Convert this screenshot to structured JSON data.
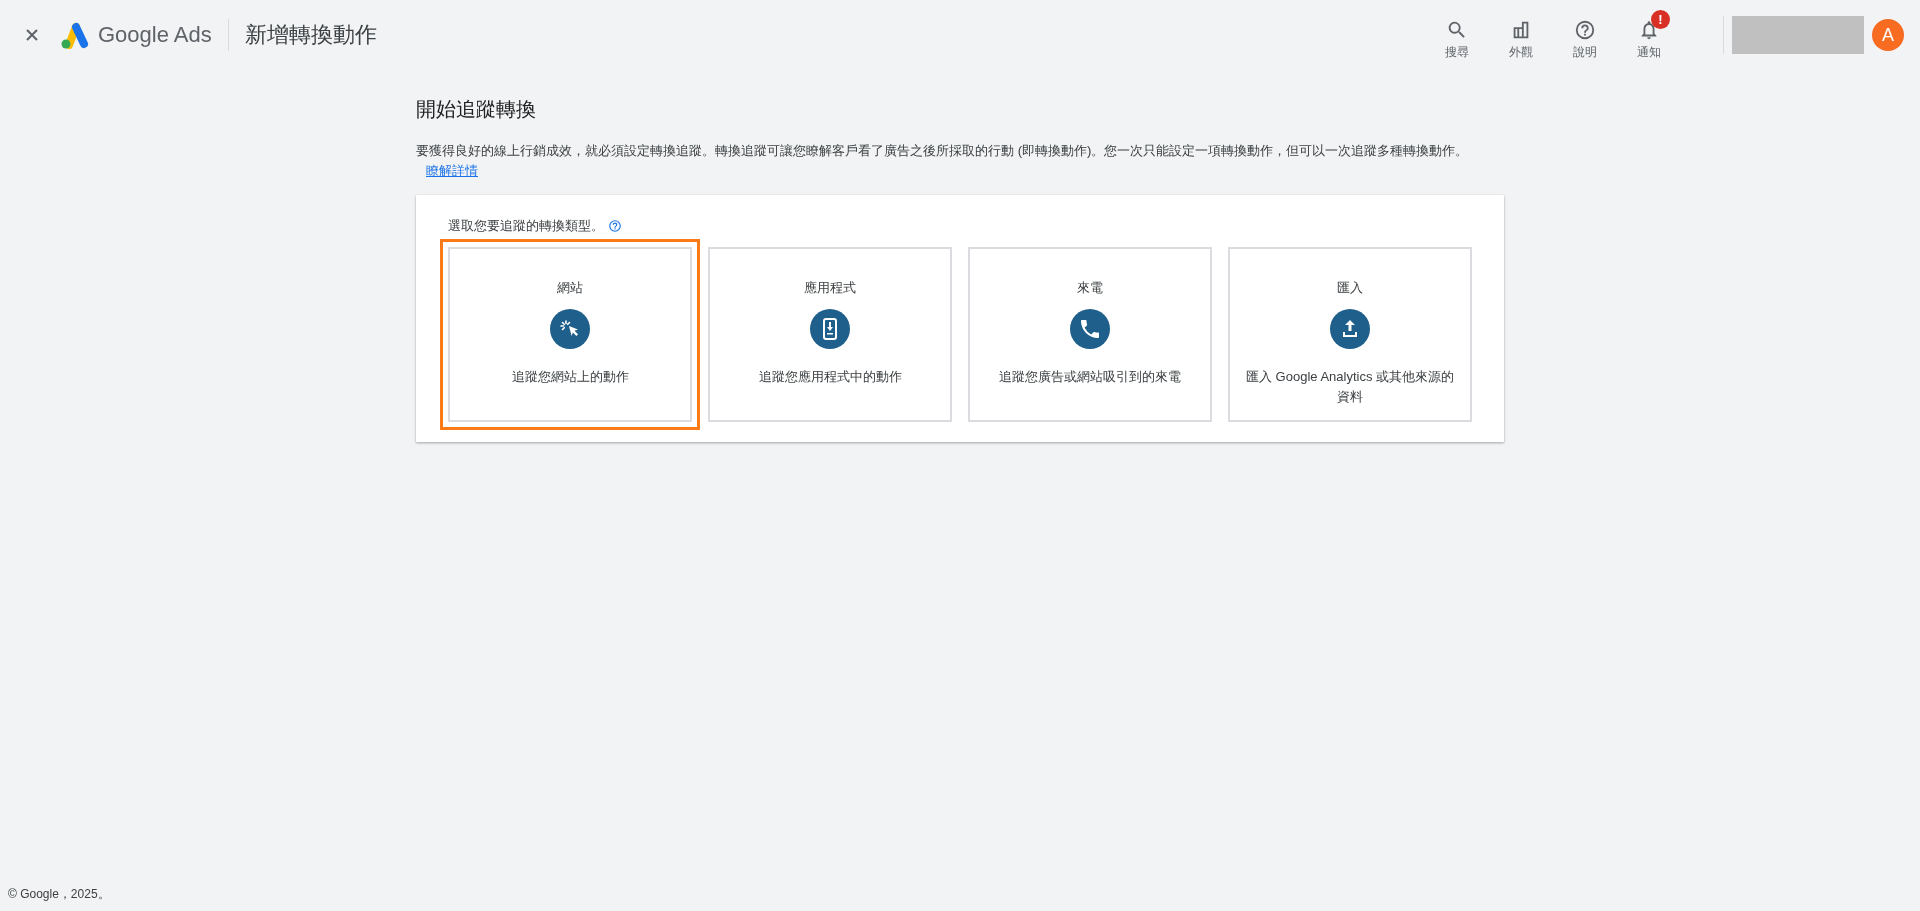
{
  "header": {
    "brand": "Google Ads",
    "title": "新增轉換動作",
    "actions": [
      {
        "label": "搜尋",
        "kind": "search"
      },
      {
        "label": "外觀",
        "kind": "appearance"
      },
      {
        "label": "說明",
        "kind": "help"
      },
      {
        "label": "通知",
        "kind": "bell",
        "badge": "!"
      }
    ],
    "avatar": "A"
  },
  "page": {
    "heading": "開始追蹤轉換",
    "intro": "要獲得良好的線上行銷成效，就必須設定轉換追蹤。轉換追蹤可讓您瞭解客戶看了廣告之後所採取的行動 (即轉換動作)。您一次只能設定一項轉換動作，但可以一次追蹤多種轉換動作。",
    "learn_more": "瞭解詳情"
  },
  "panel": {
    "prompt": "選取您要追蹤的轉換類型。",
    "options": [
      {
        "title": "網站",
        "kind": "website",
        "description": "追蹤您網站上的動作",
        "selected": true
      },
      {
        "title": "應用程式",
        "kind": "app",
        "description": "追蹤您應用程式中的動作",
        "selected": false
      },
      {
        "title": "來電",
        "kind": "phone",
        "description": "追蹤您廣告或網站吸引到的來電",
        "selected": false
      },
      {
        "title": "匯入",
        "kind": "import",
        "description": "匯入 Google Analytics 或其他來源的資料",
        "selected": false
      }
    ]
  },
  "footer": "© Google，2025。"
}
